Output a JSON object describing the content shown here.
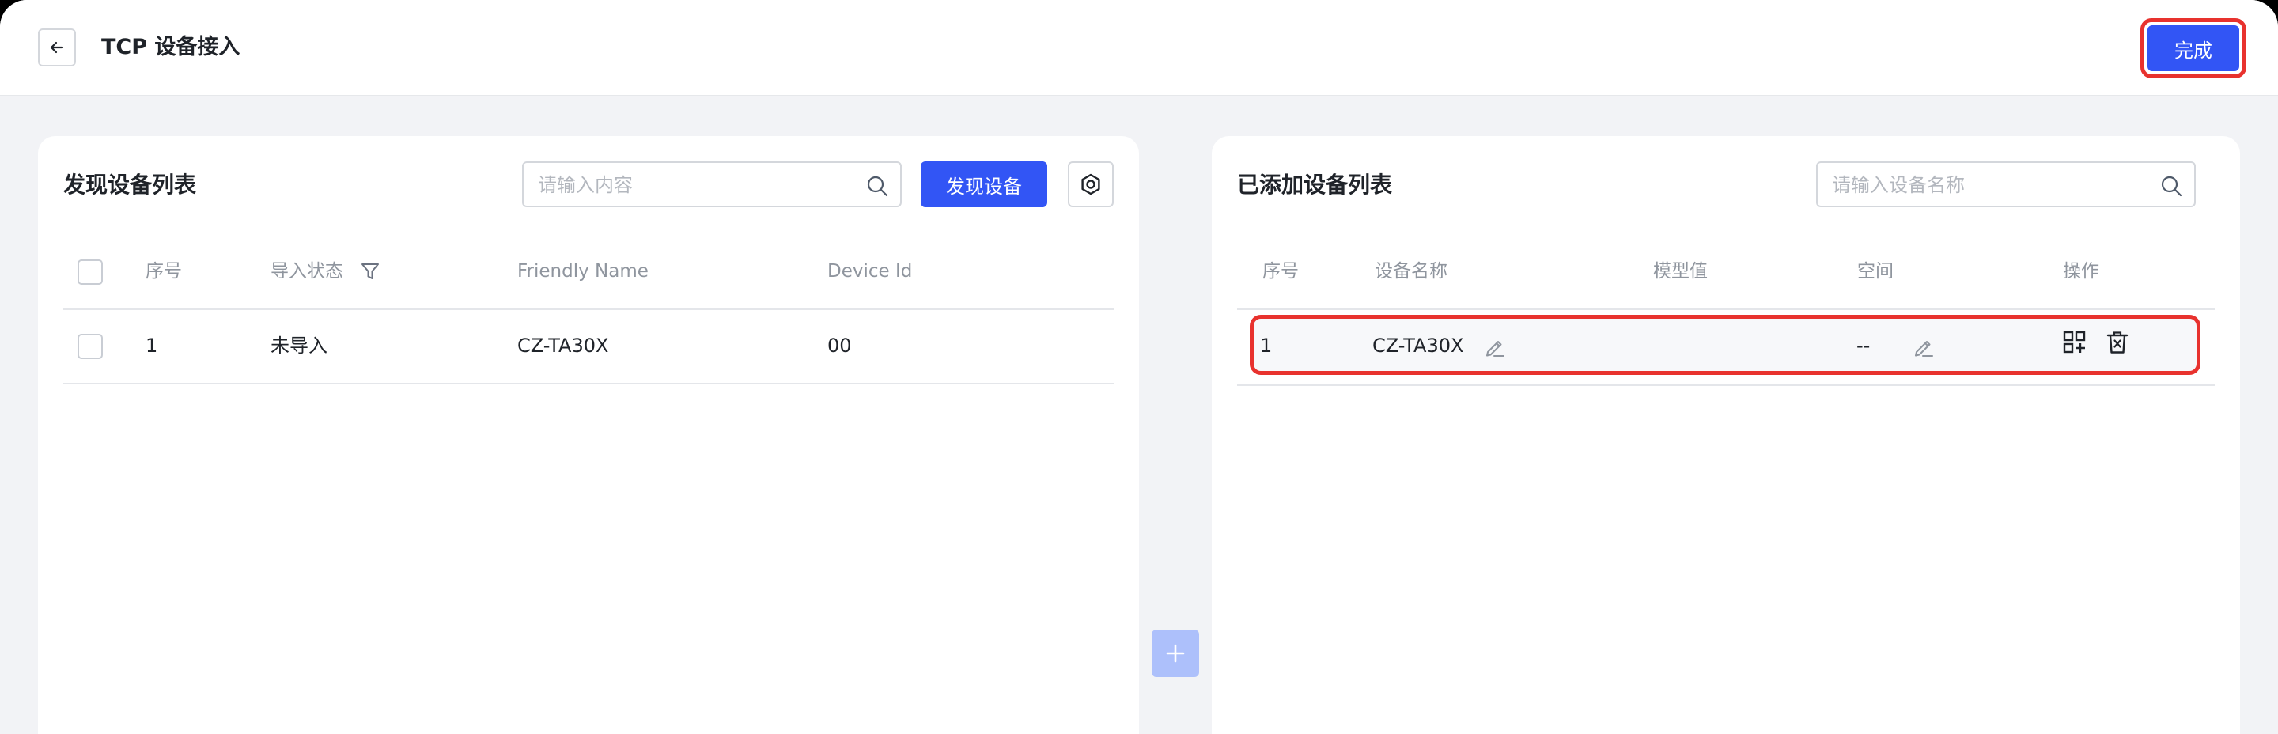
{
  "header": {
    "title": "TCP 设备接入",
    "done_label": "完成"
  },
  "left_panel": {
    "title": "发现设备列表",
    "search_placeholder": "请输入内容",
    "discover_label": "发现设备",
    "columns": [
      "序号",
      "导入状态",
      "Friendly Name",
      "Device Id"
    ],
    "rows": [
      {
        "index": "1",
        "status": "未导入",
        "friendly_name": "CZ-TA30X",
        "device_id": "00"
      }
    ]
  },
  "right_panel": {
    "title": "已添加设备列表",
    "search_placeholder": "请输入设备名称",
    "columns": [
      "序号",
      "设备名称",
      "模型值",
      "空间",
      "操作"
    ],
    "rows": [
      {
        "index": "1",
        "device_name": "CZ-TA30X",
        "model_value": "",
        "space": "--"
      }
    ]
  },
  "colors": {
    "primary": "#3255f5",
    "highlight": "#e8322e",
    "background": "#f2f3f6"
  },
  "icons": [
    "back-arrow-icon",
    "search-icon",
    "settings-hexagon-icon",
    "filter-icon",
    "edit-pencil-icon",
    "qr-code-add-icon",
    "delete-icon",
    "plus-icon"
  ]
}
